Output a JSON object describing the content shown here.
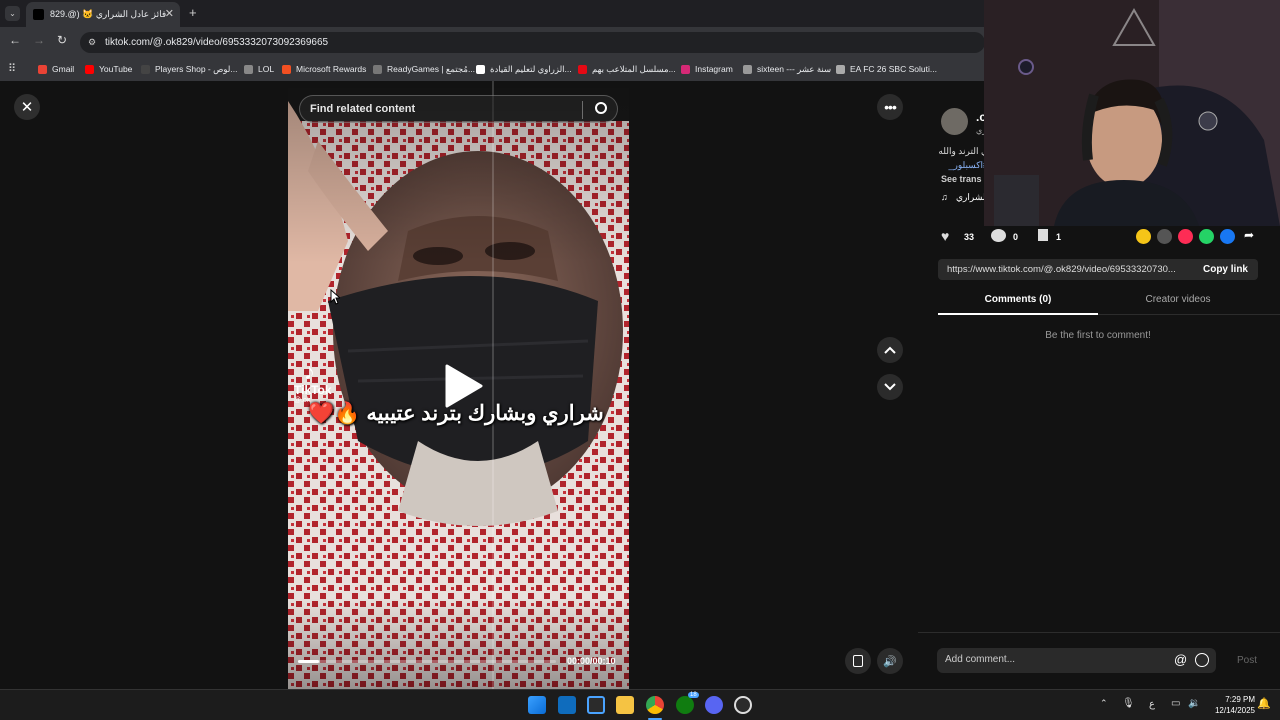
{
  "browser": {
    "tab_title": "فائز عادل الشراري 🐱 (@.829",
    "tab_close": "✕",
    "new_tab": "+",
    "url": "tiktok.com/@.ok829/video/6953332073092369665",
    "bookmarks": [
      {
        "label": "Gmail",
        "color": "#ea4335"
      },
      {
        "label": "YouTube",
        "color": "#ff0000"
      },
      {
        "label": "Players Shop - لوص...",
        "color": "#444"
      },
      {
        "label": "LOL",
        "color": "#888"
      },
      {
        "label": "Microsoft Rewards",
        "color": "#f25022"
      },
      {
        "label": "ReadyGames | مُجتمع...",
        "color": "#777"
      },
      {
        "label": "الزراوي لتعليم القيادة...",
        "color": "#fff"
      },
      {
        "label": "مسلسل المتلاعب بهم...",
        "color": "#e50914"
      },
      {
        "label": "Instagram",
        "color": "#d62976"
      },
      {
        "label": "sixteen --- سنة عشر",
        "color": "#999"
      },
      {
        "label": "EA FC 26 SBC Soluti...",
        "color": "#aaa"
      }
    ]
  },
  "video": {
    "search_placeholder": "Find related content",
    "caption": "شراري وبشارك بترند عتيبيه 🔥❤️",
    "watermark_brand": "TikTok",
    "watermark_handle": "@.ok",
    "time": "00:00/00:10",
    "progress": 0.08
  },
  "side": {
    "author_initial": ".c",
    "author_sub": "ري",
    "desc_line1": "ي الترند والله",
    "desc_tag": "#اكسبلور_",
    "see_translation": "See trans",
    "sound": "الشراري",
    "likes": "33",
    "comments_count": "0",
    "saves": "1",
    "share_url": "https://www.tiktok.com/@.ok829/video/69533320730...",
    "copy_link": "Copy link",
    "tab_comments": "Comments (0)",
    "tab_creator": "Creator videos",
    "empty_comments": "Be the first to comment!",
    "add_comment_placeholder": "Add comment...",
    "post": "Post",
    "share_colors": [
      "#f5c518",
      "#555",
      "#fe2c55",
      "#25d366",
      "#1877f2"
    ]
  },
  "taskbar": {
    "time": "7:29 PM",
    "date": "12/14/2025",
    "lang": "ع",
    "xbox_badge": "18"
  }
}
